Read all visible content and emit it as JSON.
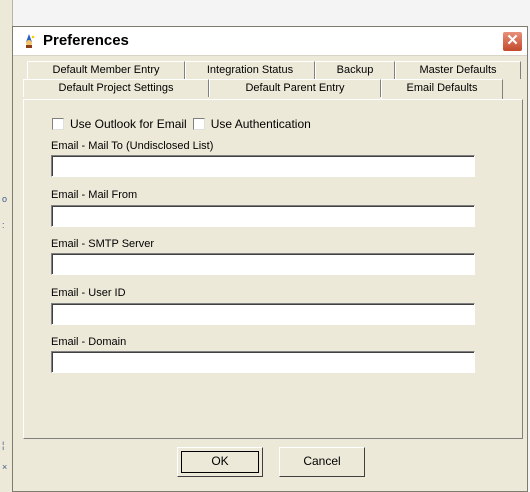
{
  "window": {
    "title": "Preferences",
    "close_symbol": "✕"
  },
  "tabs": {
    "row_back": [
      {
        "label": "Default Member Entry"
      },
      {
        "label": "Integration Status"
      },
      {
        "label": "Backup"
      },
      {
        "label": "Master Defaults"
      }
    ],
    "row_front": [
      {
        "label": "Default Project Settings"
      },
      {
        "label": "Default Parent Entry"
      },
      {
        "label": "Email Defaults",
        "selected": true
      }
    ]
  },
  "email_defaults": {
    "use_outlook_label": "Use Outlook for Email",
    "use_outlook_checked": false,
    "use_auth_label": "Use Authentication",
    "use_auth_checked": false,
    "fields": [
      {
        "label": "Email - Mail To  (Undisclosed List)",
        "value": ""
      },
      {
        "label": "Email - Mail From",
        "value": ""
      },
      {
        "label": "Email - SMTP Server",
        "value": ""
      },
      {
        "label": "Email - User ID",
        "value": ""
      },
      {
        "label": "Email - Domain",
        "value": ""
      }
    ]
  },
  "buttons": {
    "ok_label": "OK",
    "cancel_label": "Cancel"
  },
  "icons": {
    "title_icon": "wizard-icon",
    "close_icon": "close-icon"
  },
  "colors": {
    "dialog_face": "#ece9d8",
    "close_button": "#c2492c"
  }
}
